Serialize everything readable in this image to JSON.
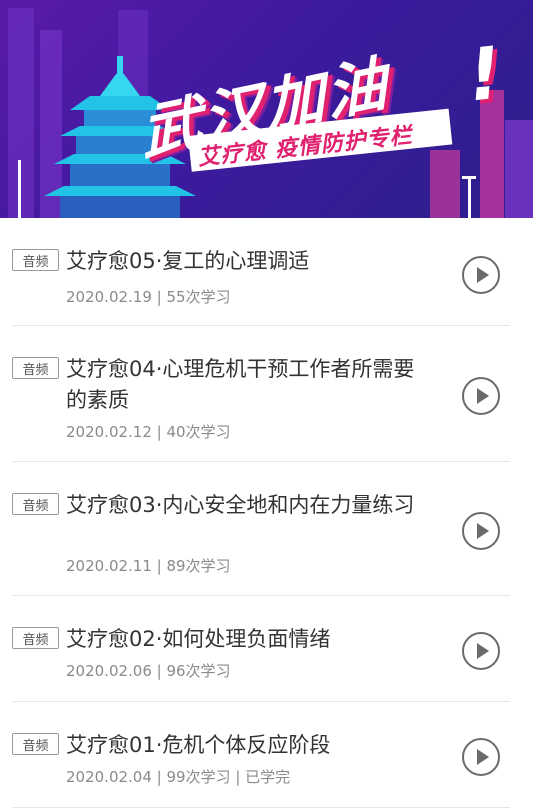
{
  "banner": {
    "title": "武汉加油",
    "exclaim": "!",
    "subtitle": "艾疗愈  疫情防护专栏"
  },
  "episodes": [
    {
      "tag": "音频",
      "title": "艾疗愈05·复工的心理调适",
      "meta": "2020.02.19 | 55次学习"
    },
    {
      "tag": "音频",
      "title": "艾疗愈04·心理危机干预工作者所需要的素质",
      "meta": "2020.02.12 | 40次学习"
    },
    {
      "tag": "音频",
      "title": "艾疗愈03·内心安全地和内在力量练习",
      "meta": "2020.02.11 | 89次学习"
    },
    {
      "tag": "音频",
      "title": "艾疗愈02·如何处理负面情绪",
      "meta": "2020.02.06 | 96次学习"
    },
    {
      "tag": "音频",
      "title": "艾疗愈01·危机个体反应阶段",
      "meta": "2020.02.04 | 99次学习 | 已学完"
    }
  ],
  "icons": {
    "play": "play-circle-icon"
  },
  "colors": {
    "banner_bg": "#3d1a9e",
    "accent": "#e0216f",
    "text": "#333333",
    "meta": "#8a8a8a"
  }
}
